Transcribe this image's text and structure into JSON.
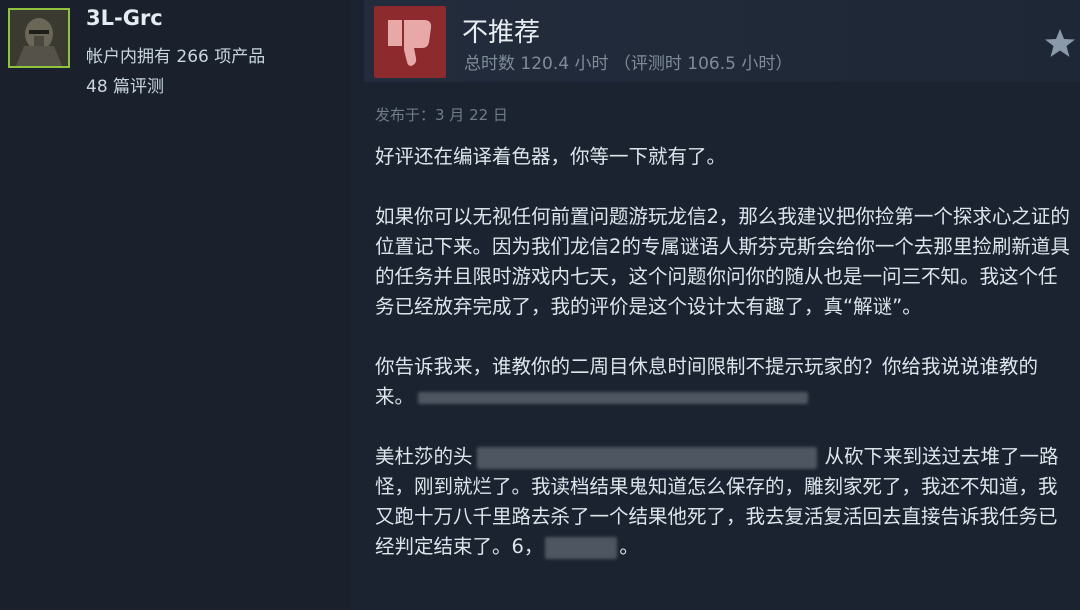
{
  "profile": {
    "username": "3L-Grc",
    "products_owned": "帐户内拥有 266 项产品",
    "review_count": "48 篇评测"
  },
  "review": {
    "verdict": "不推荐",
    "verdict_icon": "thumbs-down-icon",
    "hours": "总时数 120.4 小时  （评测时 106.5 小时）",
    "posted": "发布于：3 月 22 日",
    "paragraphs": [
      "好评还在编译着色器，你等一下就有了。",
      "如果你可以无视任何前置问题游玩龙信2，那么我建议把你捡第一个探求心之证的位置记下来。因为我们龙信2的专属谜语人斯芬克斯会给你一个去那里捡刷新道具的任务并且限时游戏内七天，这个问题你问你的随从也是一问三不知。我这个任务已经放弃完成了，我的评价是这个设计太有趣了，真“解谜”。",
      "你告诉我来，谁教你的二周目休息时间限制不提示玩家的？你给我说说谁教的来。",
      "美杜莎的头",
      "从砍下来到送过去堆了一路怪，刚到就烂了。我读档结果鬼知道怎么保存的，雕刻家死了，我还不知道，我又跑十万八千里路去杀了一个结果他死了，我去复活复活回去直接告诉我任务已经判定结束了。6，",
      "。"
    ]
  },
  "colors": {
    "background": "#1b2230",
    "thumb_box": "#8c2a2d",
    "thumb_icon": "#e8a8a8",
    "avatar_border": "#8ec23f"
  },
  "icons": {
    "star": "star-icon",
    "avatar": "knight-avatar"
  }
}
